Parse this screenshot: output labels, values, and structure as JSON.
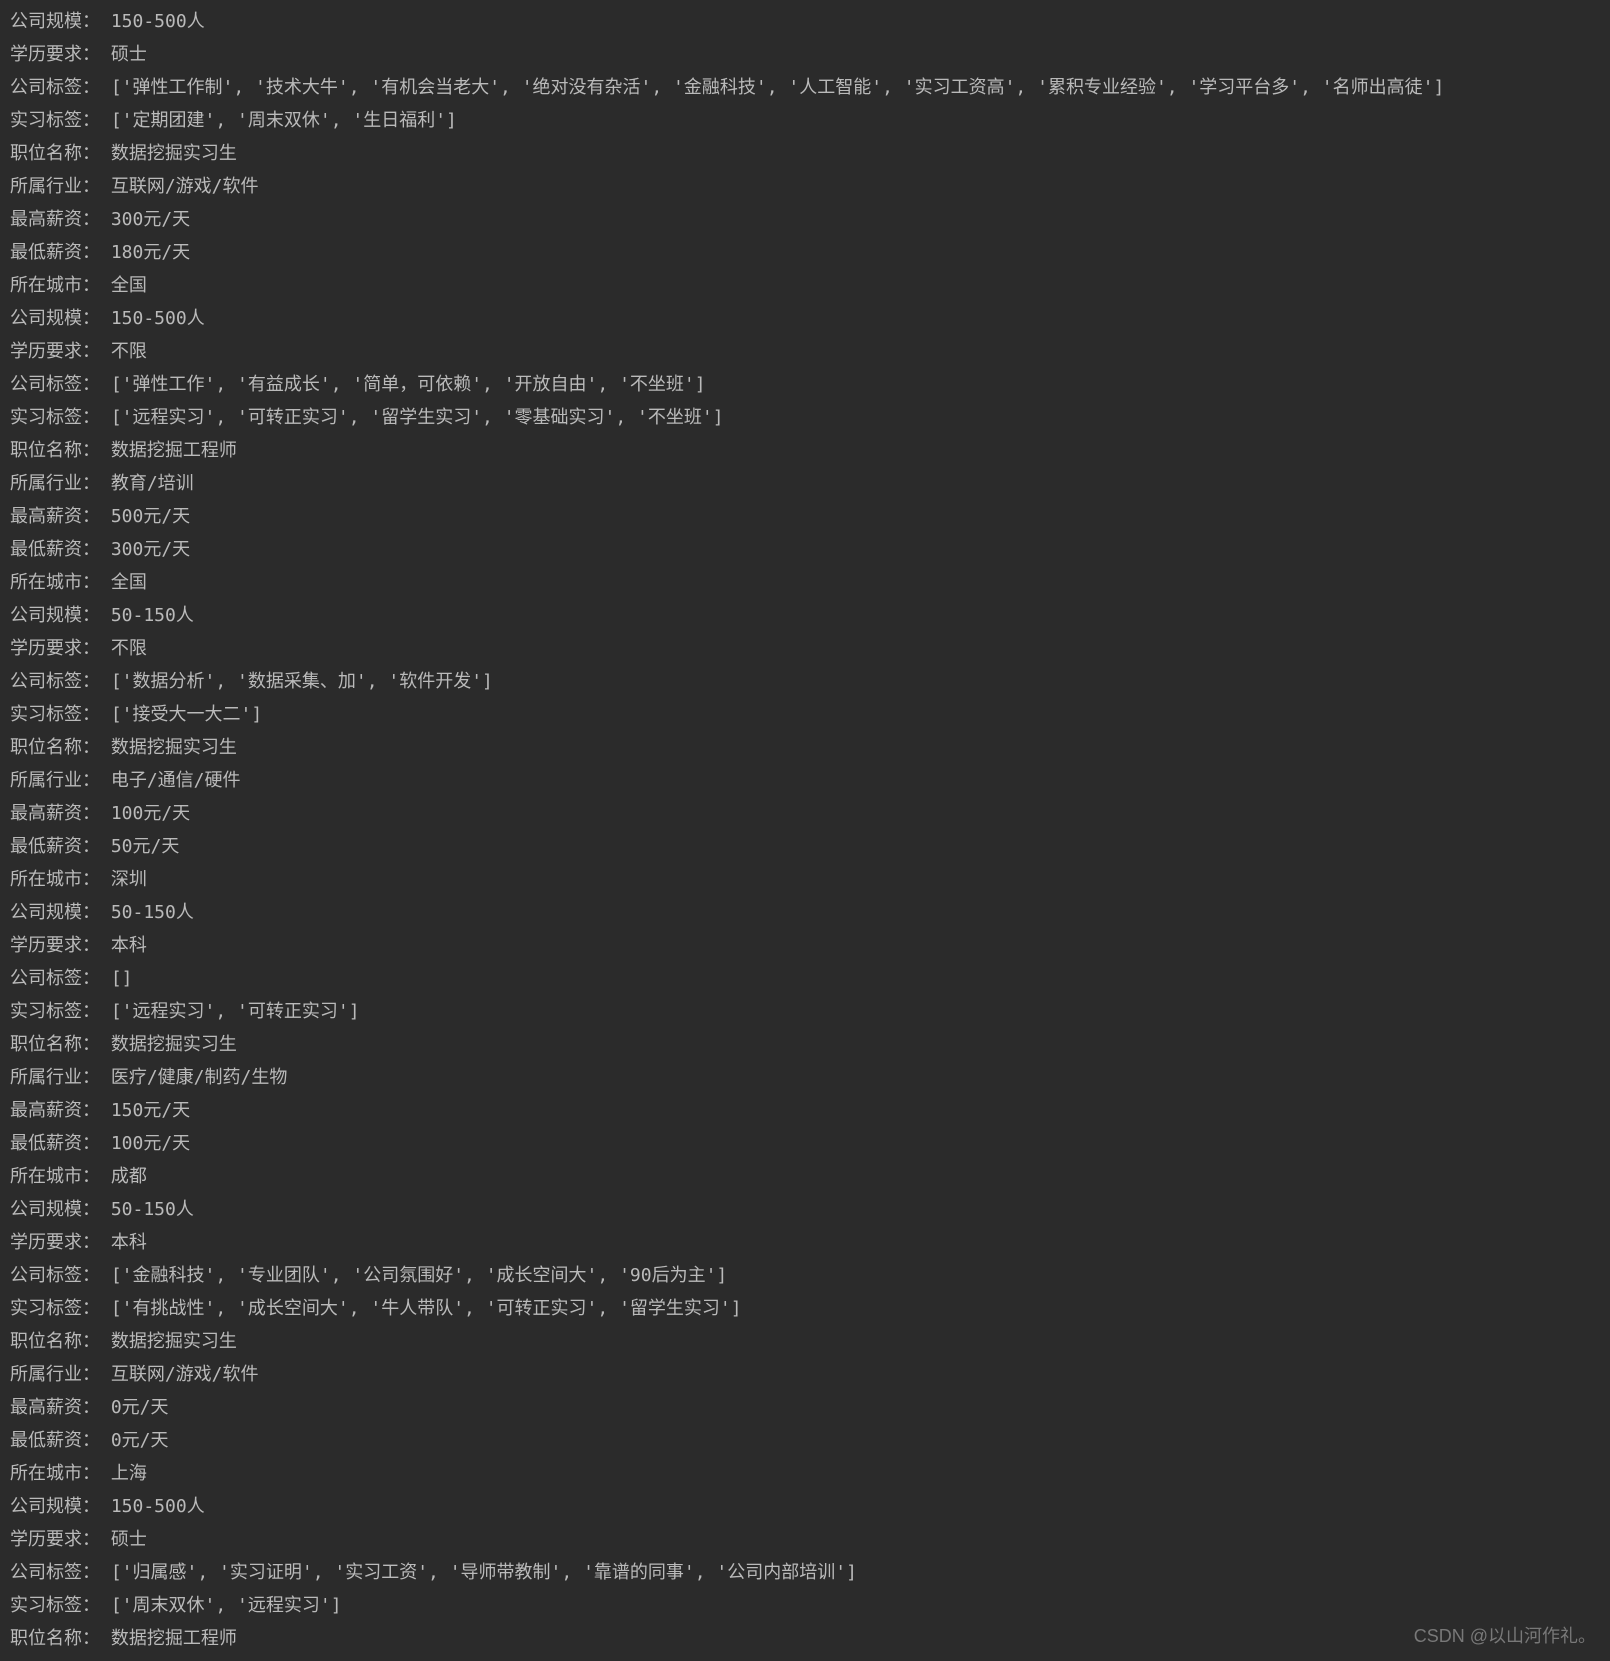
{
  "lines": [
    {
      "label": "公司规模：",
      "value": " 150-500人"
    },
    {
      "label": "学历要求：",
      "value": " 硕士"
    },
    {
      "label": "公司标签：",
      "value": " ['弹性工作制', '技术大牛', '有机会当老大', '绝对没有杂活', '金融科技', '人工智能', '实习工资高', '累积专业经验', '学习平台多', '名师出高徒']"
    },
    {
      "label": "实习标签：",
      "value": " ['定期团建', '周末双休', '生日福利']"
    },
    {
      "label": "职位名称：",
      "value": " 数据挖掘实习生"
    },
    {
      "label": "所属行业：",
      "value": " 互联网/游戏/软件"
    },
    {
      "label": "最高薪资：",
      "value": " 300元/天"
    },
    {
      "label": "最低薪资：",
      "value": " 180元/天"
    },
    {
      "label": "所在城市：",
      "value": " 全国"
    },
    {
      "label": "公司规模：",
      "value": " 150-500人"
    },
    {
      "label": "学历要求：",
      "value": " 不限"
    },
    {
      "label": "公司标签：",
      "value": " ['弹性工作', '有益成长', '简单，可依赖', '开放自由', '不坐班']"
    },
    {
      "label": "实习标签：",
      "value": " ['远程实习', '可转正实习', '留学生实习', '零基础实习', '不坐班']"
    },
    {
      "label": "职位名称：",
      "value": " 数据挖掘工程师"
    },
    {
      "label": "所属行业：",
      "value": " 教育/培训"
    },
    {
      "label": "最高薪资：",
      "value": " 500元/天"
    },
    {
      "label": "最低薪资：",
      "value": " 300元/天"
    },
    {
      "label": "所在城市：",
      "value": " 全国"
    },
    {
      "label": "公司规模：",
      "value": " 50-150人"
    },
    {
      "label": "学历要求：",
      "value": " 不限"
    },
    {
      "label": "公司标签：",
      "value": " ['数据分析', '数据采集、加', '软件开发']"
    },
    {
      "label": "实习标签：",
      "value": " ['接受大一大二']"
    },
    {
      "label": "职位名称：",
      "value": " 数据挖掘实习生"
    },
    {
      "label": "所属行业：",
      "value": " 电子/通信/硬件"
    },
    {
      "label": "最高薪资：",
      "value": " 100元/天"
    },
    {
      "label": "最低薪资：",
      "value": " 50元/天"
    },
    {
      "label": "所在城市：",
      "value": " 深圳"
    },
    {
      "label": "公司规模：",
      "value": " 50-150人"
    },
    {
      "label": "学历要求：",
      "value": " 本科"
    },
    {
      "label": "公司标签：",
      "value": " []"
    },
    {
      "label": "实习标签：",
      "value": " ['远程实习', '可转正实习']"
    },
    {
      "label": "职位名称：",
      "value": " 数据挖掘实习生"
    },
    {
      "label": "所属行业：",
      "value": " 医疗/健康/制药/生物"
    },
    {
      "label": "最高薪资：",
      "value": " 150元/天"
    },
    {
      "label": "最低薪资：",
      "value": " 100元/天"
    },
    {
      "label": "所在城市：",
      "value": " 成都"
    },
    {
      "label": "公司规模：",
      "value": " 50-150人"
    },
    {
      "label": "学历要求：",
      "value": " 本科"
    },
    {
      "label": "公司标签：",
      "value": " ['金融科技', '专业团队', '公司氛围好', '成长空间大', '90后为主']"
    },
    {
      "label": "实习标签：",
      "value": " ['有挑战性', '成长空间大', '牛人带队', '可转正实习', '留学生实习']"
    },
    {
      "label": "职位名称：",
      "value": " 数据挖掘实习生"
    },
    {
      "label": "所属行业：",
      "value": " 互联网/游戏/软件"
    },
    {
      "label": "最高薪资：",
      "value": " 0元/天"
    },
    {
      "label": "最低薪资：",
      "value": " 0元/天"
    },
    {
      "label": "所在城市：",
      "value": " 上海"
    },
    {
      "label": "公司规模：",
      "value": " 150-500人"
    },
    {
      "label": "学历要求：",
      "value": " 硕士"
    },
    {
      "label": "公司标签：",
      "value": " ['归属感', '实习证明', '实习工资', '导师带教制', '靠谱的同事', '公司内部培训']"
    },
    {
      "label": "实习标签：",
      "value": " ['周末双休', '远程实习']"
    },
    {
      "label": "职位名称：",
      "value": " 数据挖掘工程师"
    }
  ],
  "watermark": "CSDN @以山河作礼。"
}
